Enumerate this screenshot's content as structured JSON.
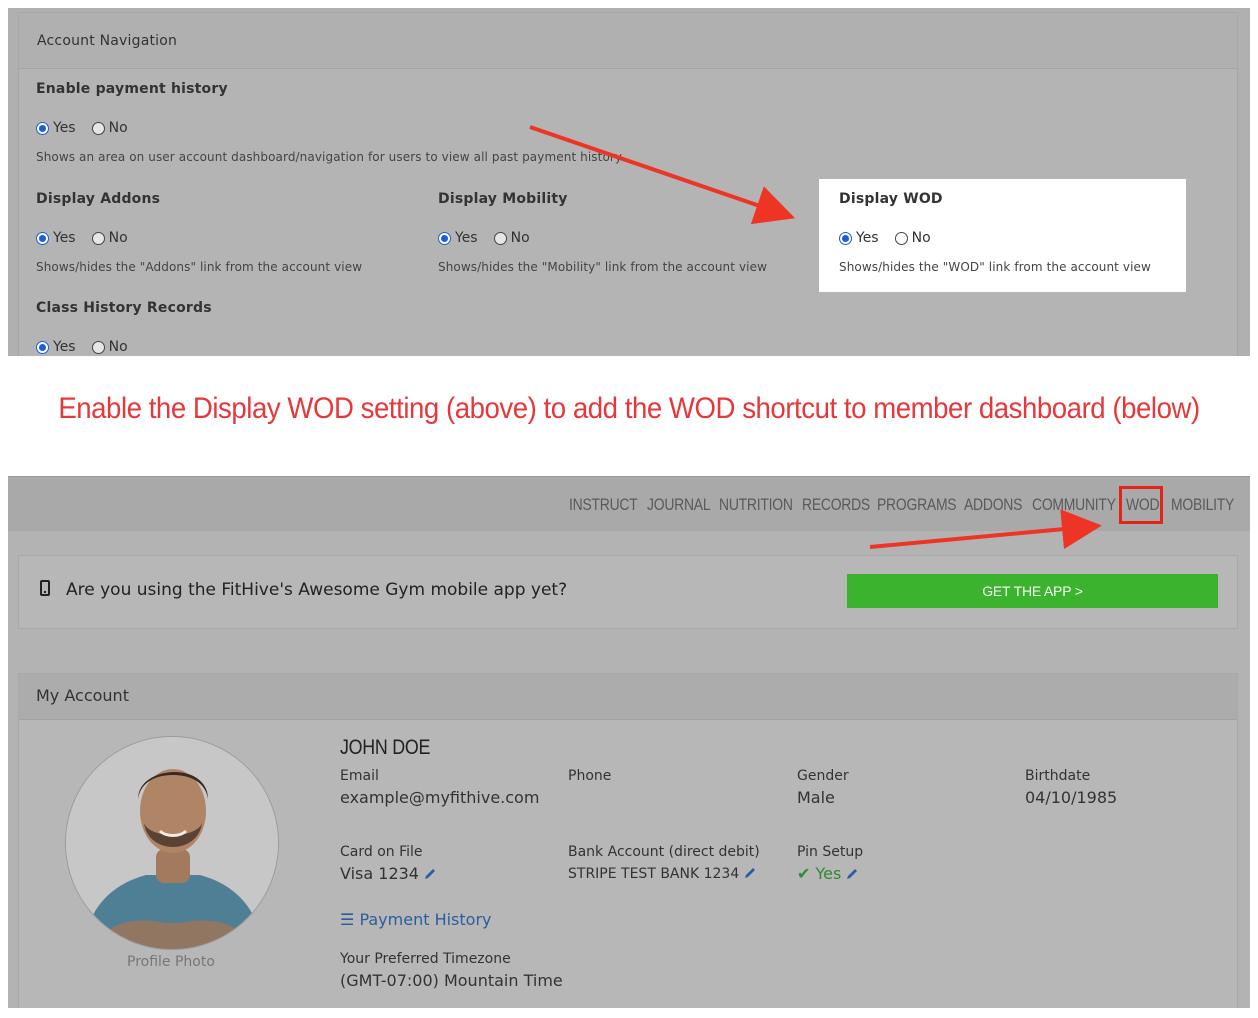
{
  "settings_panel": {
    "header": "Account Navigation",
    "settings": [
      {
        "title": "Enable payment history",
        "yes_label": "Yes",
        "no_label": "No",
        "selected": "yes",
        "help": "Shows an area on user account dashboard/navigation for users to view all past payment history"
      },
      {
        "title": "Display Addons",
        "yes_label": "Yes",
        "no_label": "No",
        "selected": "yes",
        "help": "Shows/hides the \"Addons\" link from the account view"
      },
      {
        "title": "Display Mobility",
        "yes_label": "Yes",
        "no_label": "No",
        "selected": "yes",
        "help": "Shows/hides the \"Mobility\" link from the account view"
      },
      {
        "title": "Display WOD",
        "yes_label": "Yes",
        "no_label": "No",
        "selected": "yes",
        "help": "Shows/hides the \"WOD\" link from the account view"
      },
      {
        "title": "Class History Records",
        "yes_label": "Yes",
        "no_label": "No",
        "selected": "yes",
        "help": ""
      }
    ]
  },
  "caption": "Enable the Display WOD setting (above) to add the WOD shortcut to member dashboard (below)",
  "dashboard": {
    "nav_items": [
      "INSTRUCT",
      "JOURNAL",
      "NUTRITION",
      "RECORDS",
      "PROGRAMS",
      "ADDONS",
      "COMMUNITY",
      "WOD",
      "MOBILITY"
    ],
    "app_banner": {
      "text": "Are you using the FitHive's Awesome Gym mobile app yet?",
      "button": "GET THE APP >"
    },
    "account": {
      "title": "My Account",
      "name": "JOHN DOE",
      "photo_label": "Profile Photo",
      "email_label": "Email",
      "email": "example@myfithive.com",
      "phone_label": "Phone",
      "phone": "",
      "gender_label": "Gender",
      "gender": "Male",
      "birthdate_label": "Birthdate",
      "birthdate": "04/10/1985",
      "card_label": "Card on File",
      "card": "Visa 1234",
      "bank_label": "Bank Account (direct debit)",
      "bank": "STRIPE TEST BANK 1234",
      "pin_label": "Pin Setup",
      "pin": "Yes",
      "payment_history": "Payment History",
      "timezone_label": "Your Preferred Timezone",
      "timezone": "(GMT-07:00) Mountain Time"
    }
  },
  "colors": {
    "accent_red": "#e3241b",
    "app_green": "#3cb32e",
    "radio_blue": "#1a5fd8"
  }
}
